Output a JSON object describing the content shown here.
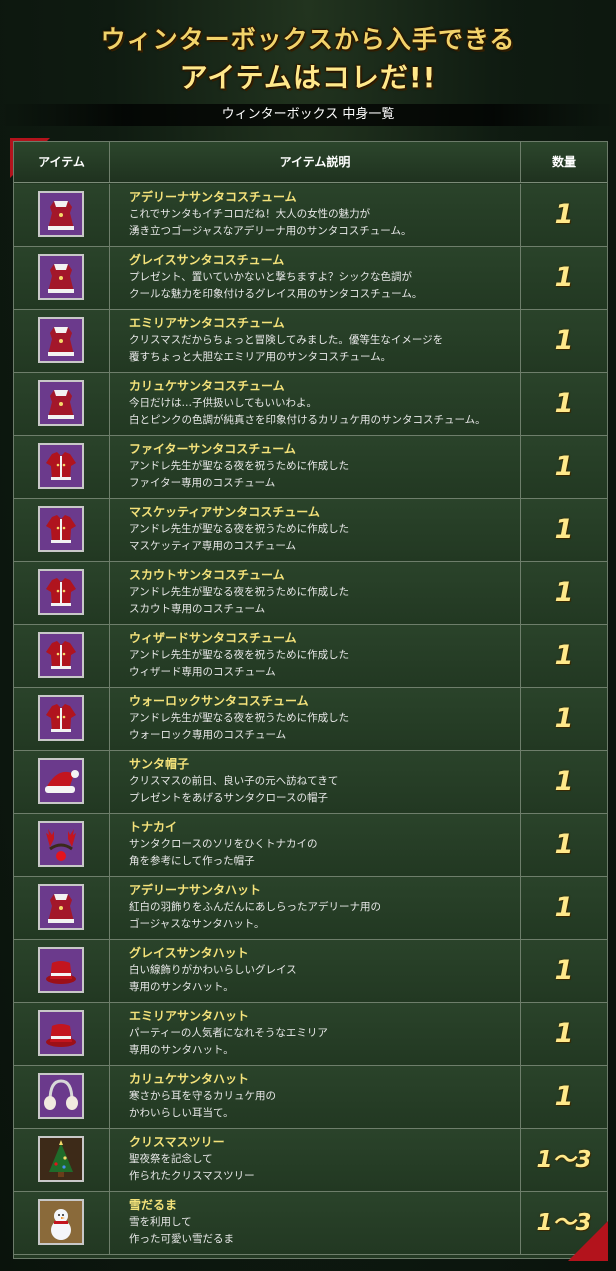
{
  "title": {
    "line1": "ウィンターボックスから入手できる",
    "line2": "アイテムはコレだ!!"
  },
  "subtitle": "ウィンターボックス 中身一覧",
  "table": {
    "headers": {
      "item": "アイテム",
      "description": "アイテム説明",
      "quantity": "数量"
    },
    "rows": [
      {
        "icon": "costume-icon",
        "name": "アデリーナサンタコスチューム",
        "desc1": "これでサンタもイチコロだね！大人の女性の魅力が",
        "desc2": "湧き立つゴージャスなアデリーナ用のサンタコスチューム。",
        "qty": "1"
      },
      {
        "icon": "costume-icon",
        "name": "グレイスサンタコスチューム",
        "desc1": "プレゼント、置いていかないと撃ちますよ？シックな色調が",
        "desc2": "クールな魅力を印象付けるグレイス用のサンタコスチューム。",
        "qty": "1"
      },
      {
        "icon": "costume-icon",
        "name": "エミリアサンタコスチューム",
        "desc1": "クリスマスだからちょっと冒険してみました。優等生なイメージを",
        "desc2": "覆すちょっと大胆なエミリア用のサンタコスチューム。",
        "qty": "1"
      },
      {
        "icon": "costume-icon",
        "name": "カリュケサンタコスチューム",
        "desc1": "今日だけは…子供扱いしてもいいわよ。",
        "desc2": "白とピンクの色調が純真さを印象付けるカリュケ用のサンタコスチューム。",
        "qty": "1"
      },
      {
        "icon": "jacket-icon",
        "name": "ファイターサンタコスチューム",
        "desc1": "アンドレ先生が聖なる夜を祝うために作成した",
        "desc2": "ファイター専用のコスチューム",
        "qty": "1"
      },
      {
        "icon": "jacket-icon",
        "name": "マスケッティアサンタコスチューム",
        "desc1": "アンドレ先生が聖なる夜を祝うために作成した",
        "desc2": "マスケッティア専用のコスチューム",
        "qty": "1"
      },
      {
        "icon": "jacket-icon",
        "name": "スカウトサンタコスチューム",
        "desc1": "アンドレ先生が聖なる夜を祝うために作成した",
        "desc2": "スカウト専用のコスチューム",
        "qty": "1"
      },
      {
        "icon": "jacket-icon",
        "name": "ウィザードサンタコスチューム",
        "desc1": "アンドレ先生が聖なる夜を祝うために作成した",
        "desc2": "ウィザード専用のコスチューム",
        "qty": "1"
      },
      {
        "icon": "jacket-icon",
        "name": "ウォーロックサンタコスチューム",
        "desc1": "アンドレ先生が聖なる夜を祝うために作成した",
        "desc2": "ウォーロック専用のコスチューム",
        "qty": "1"
      },
      {
        "icon": "santa-hat-icon",
        "name": "サンタ帽子",
        "desc1": "クリスマスの前日、良い子の元へ訪ねてきて",
        "desc2": "プレゼントをあげるサンタクロースの帽子",
        "qty": "1"
      },
      {
        "icon": "reindeer-icon",
        "name": "トナカイ",
        "desc1": "サンタクロースのソリをひくトナカイの",
        "desc2": "角を参考にして作った帽子",
        "qty": "1"
      },
      {
        "icon": "costume-icon",
        "name": "アデリーナサンタハット",
        "desc1": "紅白の羽飾りをふんだんにあしらったアデリーナ用の",
        "desc2": "ゴージャスなサンタハット。",
        "qty": "1"
      },
      {
        "icon": "hat-icon",
        "name": "グレイスサンタハット",
        "desc1": "白い線飾りがかわいらしいグレイス",
        "desc2": "専用のサンタハット。",
        "qty": "1"
      },
      {
        "icon": "hat-icon",
        "name": "エミリアサンタハット",
        "desc1": "パーティーの人気者になれそうなエミリア",
        "desc2": "専用のサンタハット。",
        "qty": "1"
      },
      {
        "icon": "earmuff-icon",
        "name": "カリュケサンタハット",
        "desc1": "寒さから耳を守るカリュケ用の",
        "desc2": "かわいらしい耳当て。",
        "qty": "1"
      },
      {
        "icon": "christmas-tree-icon",
        "name": "クリスマスツリー",
        "desc1": "聖夜祭を記念して",
        "desc2": "作られたクリスマスツリー",
        "qty": "1〜3"
      },
      {
        "icon": "snowman-icon",
        "name": "雪だるま",
        "desc1": "雪を利用して",
        "desc2": "作った可愛い雪だるま",
        "qty": "1〜3"
      }
    ]
  },
  "colors": {
    "background": "#0f1b11",
    "table": "#243a24",
    "title": "#f2d36a",
    "item_name": "#f4e27a",
    "ribbon": "#b3131c"
  }
}
